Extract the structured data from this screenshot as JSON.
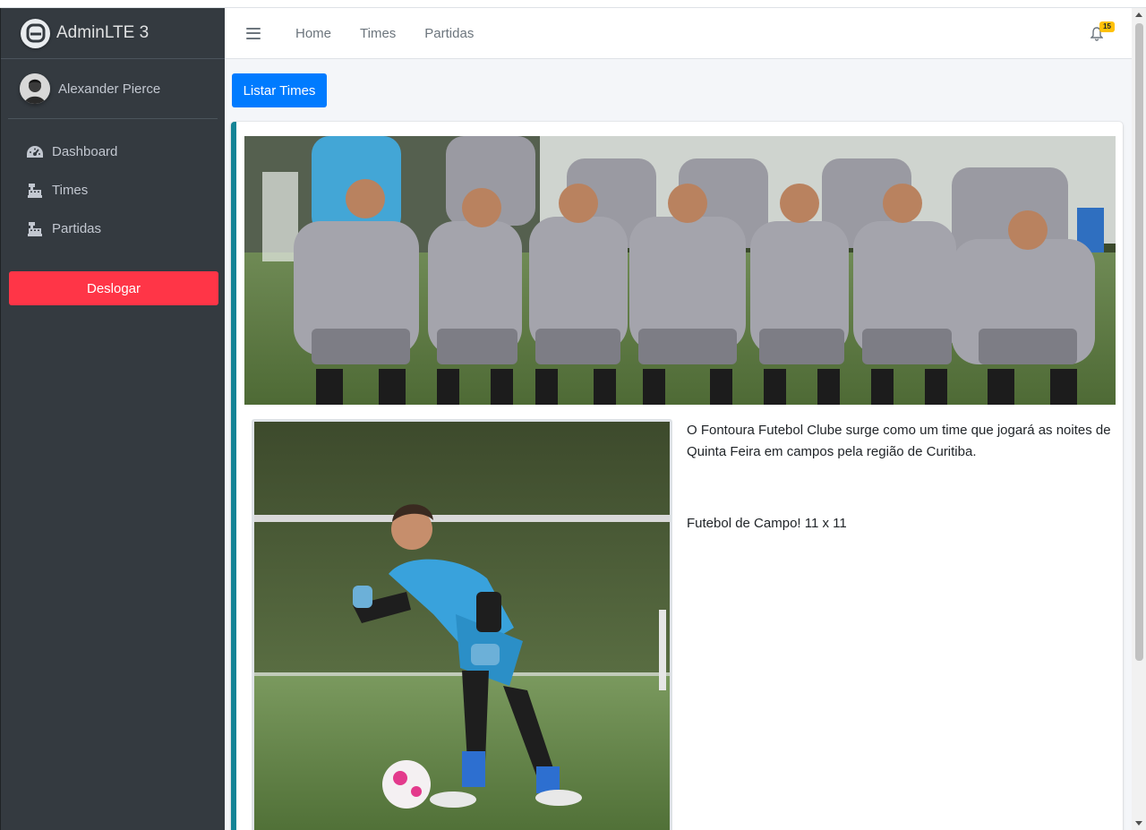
{
  "brand": {
    "title": "AdminLTE 3",
    "logo_icon": "adminlte-logo-icon"
  },
  "user": {
    "name": "Alexander Pierce",
    "avatar_icon": "user-avatar"
  },
  "sidebar": {
    "items": [
      {
        "label": "Dashboard",
        "icon": "tachometer-icon"
      },
      {
        "label": "Times",
        "icon": "cash-register-icon"
      },
      {
        "label": "Partidas",
        "icon": "cash-register-icon"
      }
    ],
    "logout_label": "Deslogar"
  },
  "navbar": {
    "links": [
      "Home",
      "Times",
      "Partidas"
    ],
    "notifications_count": "15"
  },
  "main": {
    "list_button_label": "Listar Times",
    "team_photo_alt": "team-photo",
    "goalkeeper_photo_alt": "goalkeeper-photo",
    "description": "O Fontoura Futebol Clube surge como um time que jogará as noites de Quinta Feira em campos pela região de Curitiba.",
    "format": "Futebol de Campo! 11 x 11"
  },
  "colors": {
    "sidebar_bg": "#343a40",
    "primary": "#007bff",
    "danger": "#ff3547",
    "card_accent": "#138496",
    "badge": "#ffc107"
  }
}
